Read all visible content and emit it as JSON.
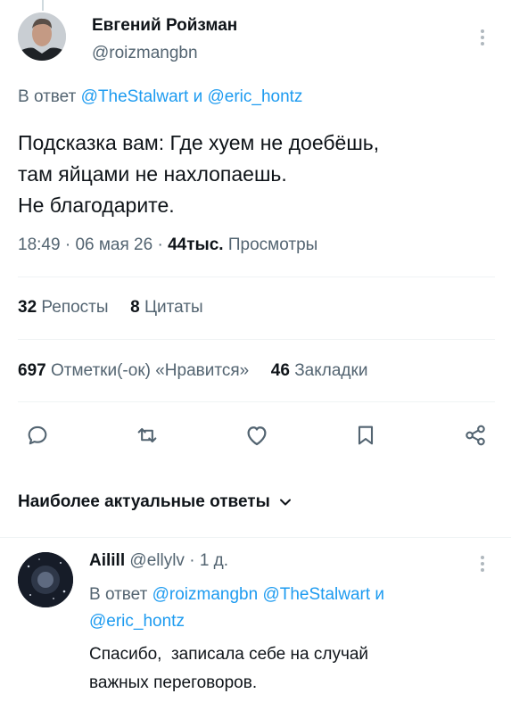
{
  "tweet": {
    "author_name": "Евгений Ройзман",
    "author_handle": "@roizmangbn",
    "reply_prefix": "В ответ",
    "reply_user1": "@TheStalwart",
    "reply_conj": "и",
    "reply_user2": "@eric_hontz",
    "text_lines": [
      "Подсказка вам: Где хуем не доебёшь,",
      "там яйцами не нахлопаешь.",
      "Не благодарите."
    ],
    "time": "18:49",
    "date": "06 мая 26",
    "views_count": "44тыс.",
    "views_label": "Просмотры"
  },
  "stats": {
    "reposts_count": "32",
    "reposts_label": "Репосты",
    "quotes_count": "8",
    "quotes_label": "Цитаты",
    "likes_count": "697",
    "likes_label": "Отметки(-ок) «Нравится»",
    "bookmarks_count": "46",
    "bookmarks_label": "Закладки"
  },
  "actions": {
    "icons": [
      "reply-icon",
      "retweet-icon",
      "like-icon",
      "bookmark-icon",
      "share-icon"
    ]
  },
  "replies_sort": {
    "label": "Наиболее актуальные ответы"
  },
  "reply": {
    "author_name": "Ailill",
    "author_handle": "@ellylv",
    "separator": "·",
    "age": "1 д.",
    "reply_prefix": "В ответ",
    "reply_user1": "@roizmangbn",
    "reply_user2": "@TheStalwart",
    "reply_conj": "и",
    "reply_user3": "@eric_hontz",
    "text_lines": [
      "Спасибо,  записала себе на случай",
      "важных переговоров."
    ]
  },
  "colors": {
    "accent": "#1d9bf0",
    "muted": "#536471",
    "text": "#0f1419",
    "divider": "#eff3f4"
  }
}
